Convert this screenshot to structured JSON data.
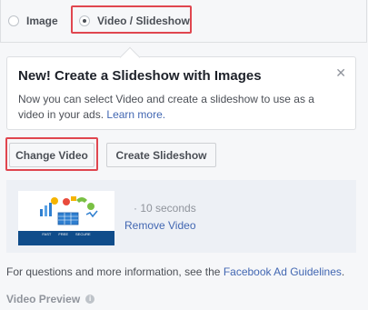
{
  "format_selector": {
    "options": [
      {
        "label": "Image",
        "selected": false
      },
      {
        "label": "Video / Slideshow",
        "selected": true
      }
    ]
  },
  "notice": {
    "title": "New! Create a Slideshow with Images",
    "body": "Now you can select Video and create a slideshow to use as a video in your ads.",
    "link": "Learn more.",
    "close_icon": "close-icon"
  },
  "buttons": {
    "change_video": "Change Video",
    "create_slideshow": "Create Slideshow"
  },
  "media": {
    "duration": "· 10 seconds",
    "remove_link": "Remove Video",
    "thumbnail_captions": [
      "FAST",
      "FREE",
      "SECURE"
    ]
  },
  "footer": {
    "text": "For questions and more information, see the",
    "link": "Facebook Ad Guidelines",
    "suffix": "."
  },
  "preview": {
    "label": "Video Preview",
    "info_icon": "info-icon"
  },
  "colors": {
    "highlight": "#e0464f",
    "link": "#4267b2",
    "thumbnail_band": "#0f4c8a"
  }
}
